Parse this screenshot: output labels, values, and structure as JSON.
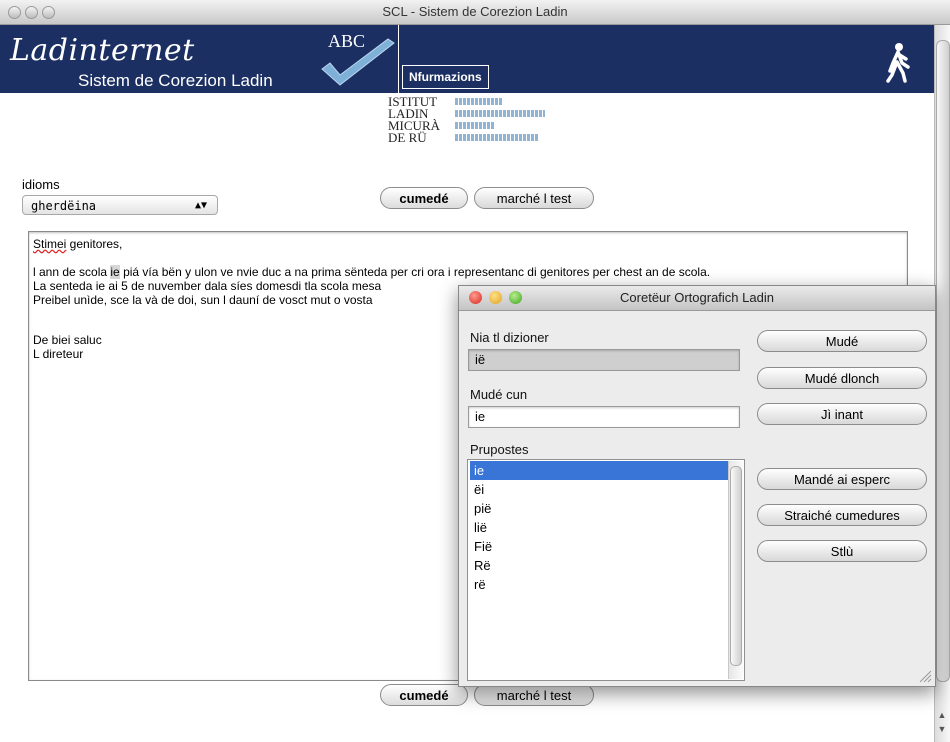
{
  "window": {
    "title": "SCL - Sistem de Corezion Ladin"
  },
  "header": {
    "logo_text": "Ladinternet",
    "logo_subtitle": "Sistem de Corezion Ladin",
    "abc_text": "ABC",
    "nfurmazions_button": "Nfurmazions",
    "walk_icon": "person-walking-icon",
    "brand_color": "#1c2f63"
  },
  "institute": {
    "lines": [
      "ISTITUT",
      "LADIN",
      "MICURÀ",
      "DE RÜ"
    ]
  },
  "form": {
    "idioms_label": "idioms",
    "idiom_selected": "gherdëina",
    "cumede_label": "cumedé",
    "marche_test_label": "marché l test"
  },
  "text": {
    "line1_word": "Stimei",
    "line1_rest": " genitores,",
    "line2_a": "l ann de scola ",
    "line2_hl": "ie",
    "line2_b": " piá vía bën y ulon ve nvie duc a na prima sënteda per cri ora i representanc di genitores per chest an de scola.",
    "line3": "La senteda ie ai 5 de nuvember dala síes domesdi tla scola mesa",
    "line4": "Preibel unìde, sce la và de doi, sun l dauní de vosct mut o vosta",
    "line5": "De biei saluc",
    "line6": "L direteur"
  },
  "dialog": {
    "title": "Coretëur Ortografich Ladin",
    "not_in_dict_label": "Nia tl dizioner",
    "not_in_dict_value": "ië",
    "change_to_label": "Mudé cun",
    "change_to_value": "ie",
    "suggestions_label": "Prupostes",
    "suggestions": [
      "ie",
      "ëi",
      "pië",
      "lië",
      "Fië",
      "Rë",
      "rë"
    ],
    "buttons": {
      "mude": "Mudé",
      "mude_dlonch": "Mudé dlonch",
      "ji_inant": "Jì inant",
      "mande": "Mandé ai esperc",
      "straiche": "Straiché cumedures",
      "stlu": "Stlù"
    },
    "selection_color": "#3875d7"
  }
}
